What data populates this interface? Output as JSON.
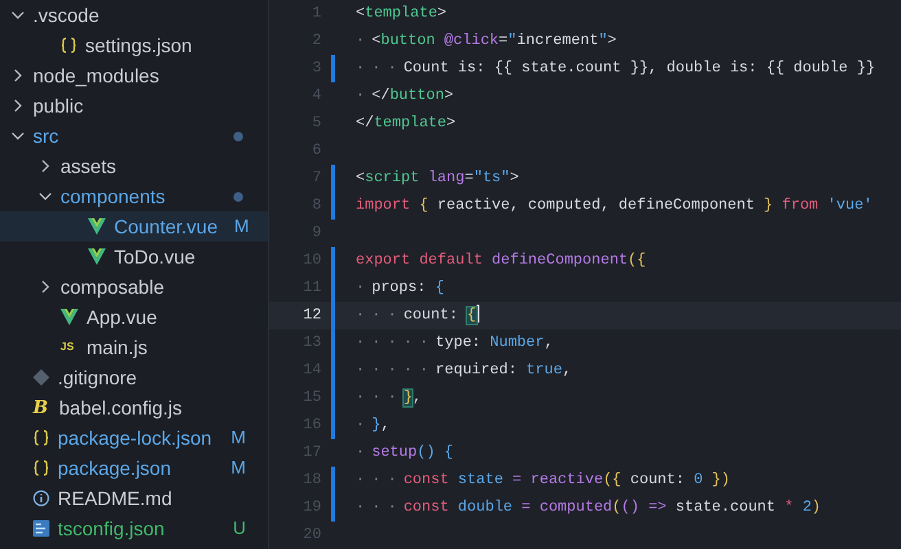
{
  "explorer": {
    "items": [
      {
        "name": ".vscode",
        "kind": "folder",
        "expanded": true,
        "color": "#c9ccd3",
        "dot": false,
        "selected": false,
        "children": [
          {
            "name": "settings.json",
            "kind": "json",
            "color": "#c9ccd3",
            "selected": false
          }
        ]
      },
      {
        "name": "node_modules",
        "kind": "folder",
        "expanded": false,
        "color": "#c9ccd3",
        "dot": false,
        "selected": false
      },
      {
        "name": "public",
        "kind": "folder",
        "expanded": false,
        "color": "#c9ccd3",
        "dot": false,
        "selected": false
      },
      {
        "name": "src",
        "kind": "folder",
        "expanded": true,
        "color": "#5ba7e8",
        "dot": true,
        "selected": false,
        "children": [
          {
            "name": "assets",
            "kind": "folder",
            "expanded": false,
            "color": "#c9ccd3",
            "dot": false,
            "selected": false
          },
          {
            "name": "components",
            "kind": "folder",
            "expanded": true,
            "color": "#5ba7e8",
            "dot": true,
            "selected": false,
            "children": [
              {
                "name": "Counter.vue",
                "kind": "vue",
                "color": "#5ba7e8",
                "badge": "M",
                "selected": true
              },
              {
                "name": "ToDo.vue",
                "kind": "vue",
                "color": "#c9ccd3",
                "selected": false
              }
            ]
          },
          {
            "name": "composable",
            "kind": "folder",
            "expanded": false,
            "color": "#c9ccd3",
            "dot": false,
            "selected": false
          },
          {
            "name": "App.vue",
            "kind": "vue",
            "color": "#c9ccd3",
            "selected": false
          },
          {
            "name": "main.js",
            "kind": "js",
            "icon_text": "JS",
            "color": "#c9ccd3",
            "selected": false
          }
        ]
      },
      {
        "name": ".gitignore",
        "kind": "git",
        "color": "#c9ccd3",
        "selected": false
      },
      {
        "name": "babel.config.js",
        "kind": "babel",
        "icon_text": "B",
        "color": "#c9ccd3",
        "selected": false
      },
      {
        "name": "package-lock.json",
        "kind": "json",
        "color": "#5ba7e8",
        "badge": "M",
        "selected": false
      },
      {
        "name": "package.json",
        "kind": "json",
        "color": "#5ba7e8",
        "badge": "M",
        "selected": false
      },
      {
        "name": "README.md",
        "kind": "info",
        "color": "#c9ccd3",
        "selected": false
      },
      {
        "name": "tsconfig.json",
        "kind": "ts",
        "color": "#3fb96b",
        "badge": "U",
        "selected": false
      }
    ]
  },
  "editor": {
    "lines": [
      {
        "number": "1",
        "modified": false,
        "active": false,
        "tokens": [
          {
            "kind": "punct",
            "text": "<"
          },
          {
            "kind": "tag",
            "text": "template"
          },
          {
            "kind": "punct",
            "text": ">"
          }
        ]
      },
      {
        "number": "2",
        "modified": false,
        "active": false,
        "tokens": [
          {
            "kind": "ws",
            "text": "·"
          },
          {
            "kind": "punct",
            "text": "<"
          },
          {
            "kind": "tag",
            "text": "button"
          },
          {
            "kind": "attr",
            "text": " @click"
          },
          {
            "kind": "punct",
            "text": "="
          },
          {
            "kind": "string",
            "text": "\""
          },
          {
            "kind": "plain",
            "text": "increment"
          },
          {
            "kind": "string",
            "text": "\""
          },
          {
            "kind": "punct",
            "text": ">"
          }
        ]
      },
      {
        "number": "3",
        "modified": true,
        "active": false,
        "tokens": [
          {
            "kind": "ws",
            "text": "···"
          },
          {
            "kind": "plain",
            "text": "Count is: {{ state.count }}, double is: {{ double }}"
          }
        ]
      },
      {
        "number": "4",
        "modified": false,
        "active": false,
        "tokens": [
          {
            "kind": "ws",
            "text": "·"
          },
          {
            "kind": "punct",
            "text": "</"
          },
          {
            "kind": "tag",
            "text": "button"
          },
          {
            "kind": "punct",
            "text": ">"
          }
        ]
      },
      {
        "number": "5",
        "modified": false,
        "active": false,
        "tokens": [
          {
            "kind": "punct",
            "text": "</"
          },
          {
            "kind": "tag",
            "text": "template"
          },
          {
            "kind": "punct",
            "text": ">"
          }
        ]
      },
      {
        "number": "6",
        "modified": false,
        "active": false
      },
      {
        "number": "7",
        "modified": true,
        "active": false,
        "tokens": [
          {
            "kind": "punct",
            "text": "<"
          },
          {
            "kind": "tag",
            "text": "script"
          },
          {
            "kind": "attr",
            "text": " lang"
          },
          {
            "kind": "punct",
            "text": "="
          },
          {
            "kind": "value",
            "text": "\"ts\""
          },
          {
            "kind": "punct",
            "text": ">"
          }
        ]
      },
      {
        "number": "8",
        "modified": true,
        "active": false,
        "tokens": [
          {
            "kind": "keyword",
            "text": "import"
          },
          {
            "kind": "brace",
            "text": " {"
          },
          {
            "kind": "plain",
            "text": " reactive, computed, defineComponent"
          },
          {
            "kind": "brace",
            "text": " }"
          },
          {
            "kind": "keyword",
            "text": " from"
          },
          {
            "kind": "value",
            "text": " 'vue'"
          }
        ]
      },
      {
        "number": "9",
        "modified": false,
        "active": false
      },
      {
        "number": "10",
        "modified": true,
        "active": false,
        "tokens": [
          {
            "kind": "keyword",
            "text": "export default"
          },
          {
            "kind": "fn",
            "text": " defineComponent"
          },
          {
            "kind": "brace",
            "text": "({"
          }
        ]
      },
      {
        "number": "11",
        "modified": true,
        "active": false,
        "tokens": [
          {
            "kind": "ws",
            "text": "·"
          },
          {
            "kind": "plain",
            "text": "props:"
          },
          {
            "kind": "value",
            "text": " {"
          }
        ]
      },
      {
        "number": "12",
        "modified": true,
        "active": true,
        "tokens": [
          {
            "kind": "ws",
            "text": "···"
          },
          {
            "kind": "plain",
            "text": "count: "
          },
          {
            "kind": "match",
            "text": "{"
          }
        ]
      },
      {
        "number": "13",
        "modified": true,
        "active": false,
        "tokens": [
          {
            "kind": "ws",
            "text": "·····"
          },
          {
            "kind": "plain",
            "text": "type:"
          },
          {
            "kind": "value",
            "text": " Number"
          },
          {
            "kind": "plain",
            "text": ","
          }
        ]
      },
      {
        "number": "14",
        "modified": true,
        "active": false,
        "tokens": [
          {
            "kind": "ws",
            "text": "·····"
          },
          {
            "kind": "plain",
            "text": "required:"
          },
          {
            "kind": "value",
            "text": " true"
          },
          {
            "kind": "plain",
            "text": ","
          }
        ]
      },
      {
        "number": "15",
        "modified": true,
        "active": false,
        "tokens": [
          {
            "kind": "ws",
            "text": "···"
          },
          {
            "kind": "match",
            "text": "}"
          },
          {
            "kind": "plain",
            "text": ","
          }
        ]
      },
      {
        "number": "16",
        "modified": true,
        "active": false,
        "tokens": [
          {
            "kind": "ws",
            "text": "·"
          },
          {
            "kind": "value",
            "text": "}"
          },
          {
            "kind": "plain",
            "text": ","
          }
        ]
      },
      {
        "number": "17",
        "modified": false,
        "active": false,
        "tokens": [
          {
            "kind": "ws",
            "text": "·"
          },
          {
            "kind": "fn",
            "text": "setup"
          },
          {
            "kind": "value",
            "text": "() {"
          }
        ]
      },
      {
        "number": "18",
        "modified": true,
        "active": false,
        "tokens": [
          {
            "kind": "ws",
            "text": "···"
          },
          {
            "kind": "keyword",
            "text": "const"
          },
          {
            "kind": "value",
            "text": " state"
          },
          {
            "kind": "fn",
            "text": " = reactive"
          },
          {
            "kind": "brace",
            "text": "({"
          },
          {
            "kind": "plain",
            "text": " count: "
          },
          {
            "kind": "value",
            "text": "0"
          },
          {
            "kind": "brace",
            "text": " })"
          }
        ]
      },
      {
        "number": "19",
        "modified": true,
        "active": false,
        "tokens": [
          {
            "kind": "ws",
            "text": "···"
          },
          {
            "kind": "keyword",
            "text": "const"
          },
          {
            "kind": "value",
            "text": " double"
          },
          {
            "kind": "fn",
            "text": " = computed"
          },
          {
            "kind": "brace",
            "text": "("
          },
          {
            "kind": "fn",
            "text": "() =>"
          },
          {
            "kind": "plain",
            "text": " state.count"
          },
          {
            "kind": "keyword",
            "text": " *"
          },
          {
            "kind": "value",
            "text": " 2"
          },
          {
            "kind": "brace",
            "text": ")"
          }
        ]
      },
      {
        "number": "20",
        "modified": false,
        "active": false
      }
    ]
  }
}
